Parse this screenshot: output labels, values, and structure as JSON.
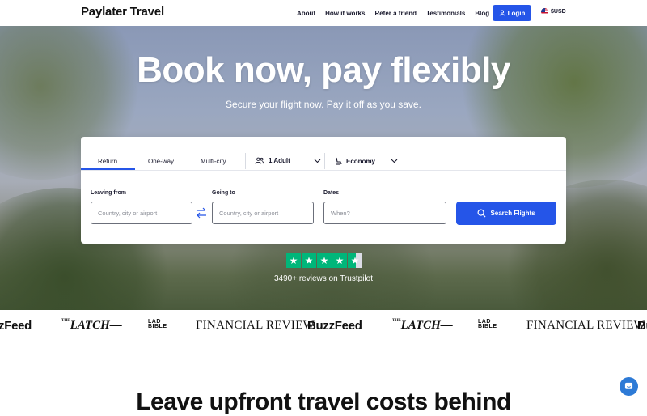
{
  "header": {
    "logo": "Paylater Travel",
    "nav": [
      "About",
      "How it works",
      "Refer a friend",
      "Testimonials",
      "Blog"
    ],
    "login_label": "Login",
    "currency_label": "$USD"
  },
  "hero": {
    "title": "Book now, pay flexibly",
    "subtitle": "Secure your flight now. Pay it off as you save."
  },
  "search": {
    "tabs": [
      "Return",
      "One-way",
      "Multi-city"
    ],
    "active_tab": "Return",
    "passengers": "1 Adult",
    "cabin": "Economy",
    "leaving_label": "Leaving from",
    "leaving_placeholder": "Country, city or airport",
    "going_label": "Going to",
    "going_placeholder": "Country, city or airport",
    "dates_label": "Dates",
    "dates_placeholder": "When?",
    "button_label": "Search Flights"
  },
  "trustpilot": {
    "rating_stars": 4.5,
    "reviews_text": "3490+ reviews on Trustpilot"
  },
  "press": [
    "zFeed",
    "THE LATCH",
    "LAD BIBLE",
    "FINANCIAL REVIEW",
    "BuzzFeed",
    "THE LATCH",
    "LAD BIBLE",
    "FINANCIAL REVIEW",
    "Bu"
  ],
  "bottom": {
    "heading": "Leave upfront travel costs behind"
  },
  "colors": {
    "accent": "#2555e8",
    "trustpilot_green": "#00b67a",
    "chat": "#2d7ad6"
  }
}
